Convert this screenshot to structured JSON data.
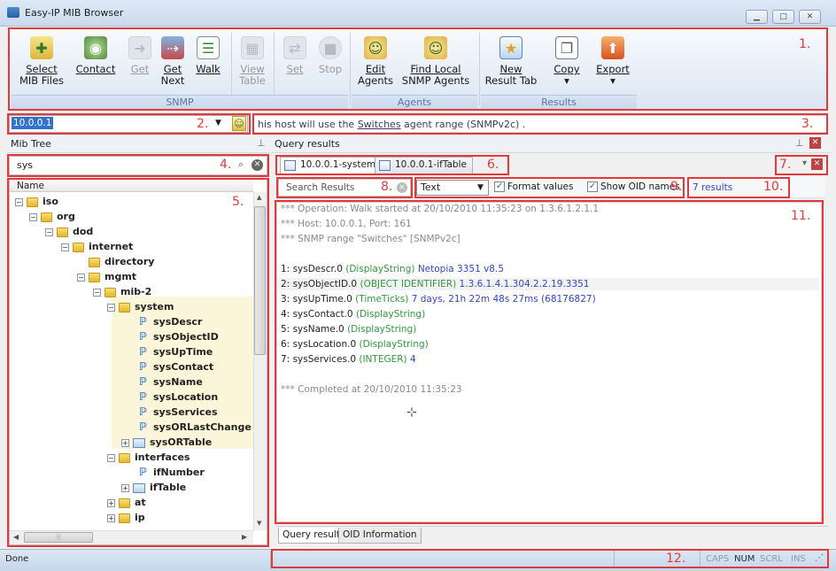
{
  "window": {
    "title": "Easy-IP MIB Browser"
  },
  "ribbon": {
    "buttons": [
      {
        "line1": "Select",
        "line2": "MIB Files",
        "icon": "select-mib-files-icon"
      },
      {
        "line1": "Contact",
        "line2": "",
        "icon": "contact-icon"
      },
      {
        "line1": "Get",
        "line2": "",
        "icon": "get-icon"
      },
      {
        "line1": "Get",
        "line2": "Next",
        "icon": "get-next-icon"
      },
      {
        "line1": "Walk",
        "line2": "",
        "icon": "walk-icon"
      },
      {
        "line1": "View",
        "line2": "Table",
        "icon": "view-table-icon"
      },
      {
        "line1": "Set",
        "line2": "",
        "icon": "set-icon"
      },
      {
        "line1": "Stop",
        "line2": "",
        "icon": "stop-icon"
      },
      {
        "line1": "Edit",
        "line2": "Agents",
        "icon": "edit-agents-icon"
      },
      {
        "line1": "Find Local",
        "line2": "SNMP Agents",
        "icon": "find-agents-icon"
      },
      {
        "line1": "New",
        "line2": "Result Tab",
        "icon": "new-result-tab-icon"
      },
      {
        "line1": "Copy",
        "line2": "▾",
        "icon": "copy-icon"
      },
      {
        "line1": "Export",
        "line2": "▾",
        "icon": "export-icon"
      }
    ],
    "groups": [
      "SNMP",
      "Agents",
      "Results"
    ]
  },
  "annotations": [
    "1.",
    "2.",
    "3.",
    "4.",
    "5.",
    "6.",
    "7.",
    "8.",
    "9.",
    "10.",
    "11.",
    "12."
  ],
  "host": {
    "address": "10.0.0.1",
    "info_prefix": "his host will use the ",
    "info_link": "Switches",
    "info_suffix": " agent range (SNMPv2c) ."
  },
  "mib_tree": {
    "header": "Mib Tree",
    "search": "sys",
    "column": "Name",
    "nodes": [
      "iso",
      "org",
      "dod",
      "internet",
      "directory",
      "mgmt",
      "mib-2",
      "system",
      "sysDescr",
      "sysObjectID",
      "sysUpTime",
      "sysContact",
      "sysName",
      "sysLocation",
      "sysServices",
      "sysORLastChange",
      "sysORTable",
      "interfaces",
      "ifNumber",
      "ifTable",
      "at",
      "ip"
    ]
  },
  "query": {
    "header": "Query results",
    "tabs": [
      "10.0.0.1-system",
      "10.0.0.1-ifTable"
    ],
    "search_placeholder": "Search Results",
    "format": "Text",
    "format_values_label": "Format values",
    "show_oid_label": "Show OID names",
    "result_count": "7 results",
    "output": {
      "op_line": "*** Operation: Walk started at 20/10/2010 11:35:23 on 1.3.6.1.2.1.1",
      "host_line": "*** Host: 10.0.0.1, Port: 161",
      "range_line": "*** SNMP range \"Switches\" [SNMPv2c]",
      "results": [
        {
          "idx": "1:",
          "name": "sysDescr.0",
          "type": "(DisplayString)",
          "value": "Netopia 3351 v8.5"
        },
        {
          "idx": "2:",
          "name": "sysObjectID.0",
          "type": "(OBJECT IDENTIFIER)",
          "value": "1.3.6.1.4.1.304.2.2.19.3351"
        },
        {
          "idx": "3:",
          "name": "sysUpTime.0",
          "type": "(TimeTicks)",
          "value": "7 days, 21h 22m 48s 27ms (68176827)"
        },
        {
          "idx": "4:",
          "name": "sysContact.0",
          "type": "(DisplayString)",
          "value": ""
        },
        {
          "idx": "5:",
          "name": "sysName.0",
          "type": "(DisplayString)",
          "value": ""
        },
        {
          "idx": "6:",
          "name": "sysLocation.0",
          "type": "(DisplayString)",
          "value": ""
        },
        {
          "idx": "7:",
          "name": "sysServices.0",
          "type": "(INTEGER)",
          "value": "4"
        }
      ],
      "completed": "*** Completed at 20/10/2010 11:35:23"
    },
    "bottom_tabs": [
      "Query results",
      "OID Information"
    ]
  },
  "status": {
    "text": "Done",
    "caps": "CAPS",
    "num": "NUM",
    "scrl": "SCRL",
    "ins": "INS"
  }
}
